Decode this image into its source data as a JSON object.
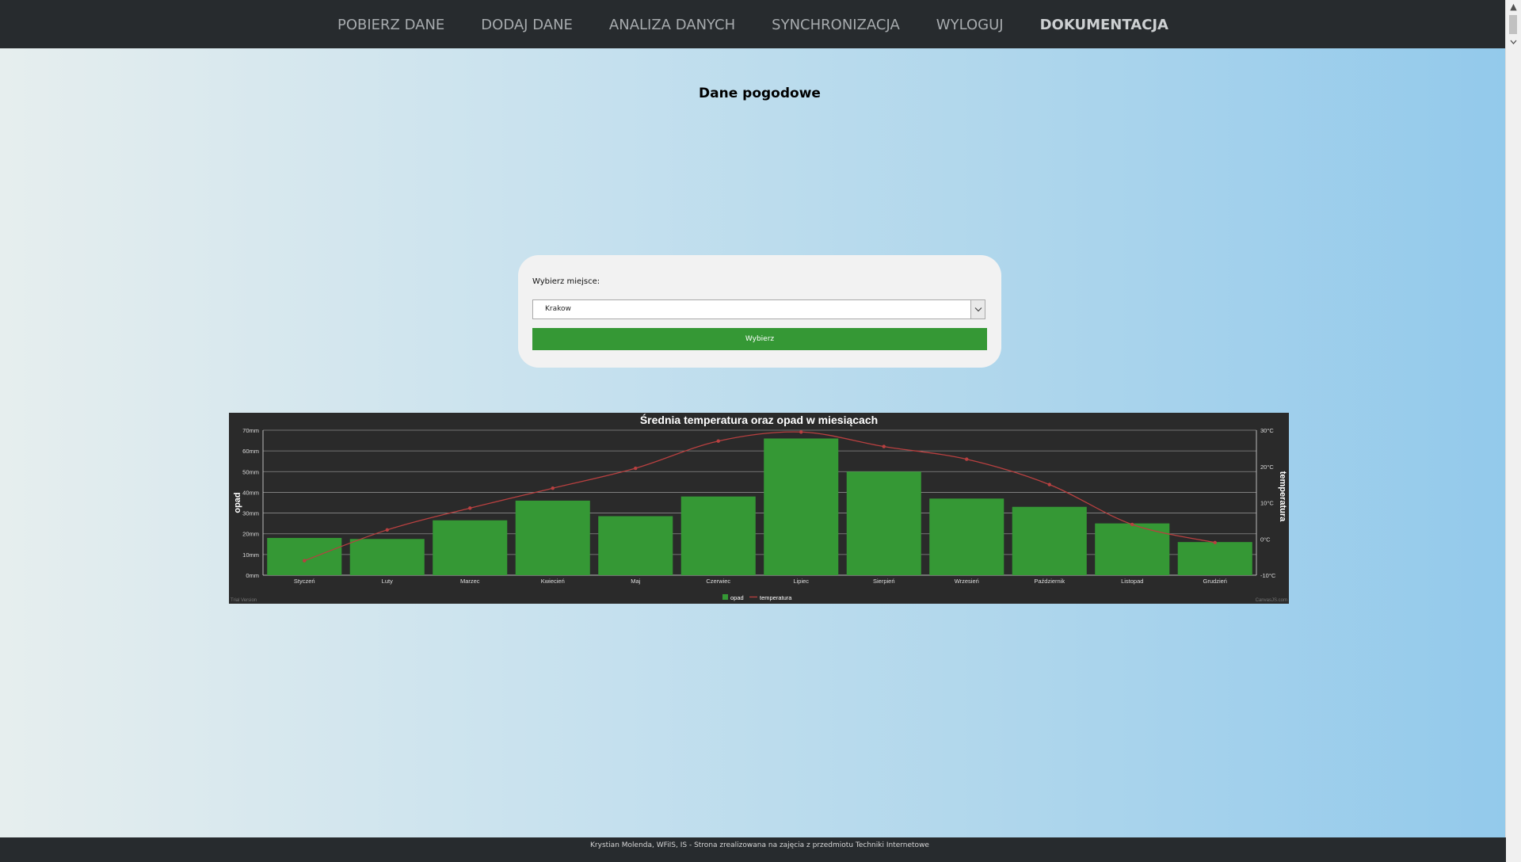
{
  "nav": {
    "items": [
      {
        "label": "POBIERZ DANE"
      },
      {
        "label": "DODAJ DANE"
      },
      {
        "label": "ANALIZA DANYCH"
      },
      {
        "label": "SYNCHRONIZACJA"
      },
      {
        "label": "WYLOGUJ"
      },
      {
        "label": "DOKUMENTACJA"
      }
    ]
  },
  "page": {
    "title": "Dane pogodowe"
  },
  "form": {
    "label": "Wybierz miejsce:",
    "selected_place": "Krakow",
    "button_label": "Wybierz"
  },
  "footer": {
    "text": "Krystian Molenda, WFiIS, IS - Strona zrealizowana na zajęcia z przedmiotu Techniki Internetowe"
  },
  "chart_data": {
    "type": "bar",
    "title": "Średnia temperatura oraz opad w miesiącach",
    "categories": [
      "Styczeń",
      "Luty",
      "Marzec",
      "Kwiecień",
      "Maj",
      "Czerwiec",
      "Lipiec",
      "Sierpień",
      "Wrzesień",
      "Październik",
      "Listopad",
      "Grudzień"
    ],
    "series": [
      {
        "name": "opad",
        "type": "bar",
        "axis": "left",
        "values": [
          18,
          17.5,
          26.5,
          36,
          28.5,
          38,
          66,
          50,
          37,
          33,
          25,
          16
        ],
        "color": "#359835"
      },
      {
        "name": "temperatura",
        "type": "line",
        "axis": "right",
        "values": [
          -6,
          2.5,
          8.5,
          14,
          19.5,
          27,
          29.5,
          25.5,
          22,
          15,
          4,
          -1
        ],
        "color": "#b84040"
      }
    ],
    "ylabel": "opad",
    "ylabel_right": "temperatura",
    "ylim": [
      0,
      70
    ],
    "ylim_right": [
      -10,
      30
    ],
    "yticks": [
      "0mm",
      "10mm",
      "20mm",
      "30mm",
      "40mm",
      "50mm",
      "60mm",
      "70mm"
    ],
    "yticks_right": [
      "-10°C",
      "0°C",
      "10°C",
      "20°C",
      "30°C"
    ],
    "grid": true,
    "legend": "bottom",
    "watermark_left": "Trial Version",
    "watermark_right": "CanvasJS.com"
  }
}
